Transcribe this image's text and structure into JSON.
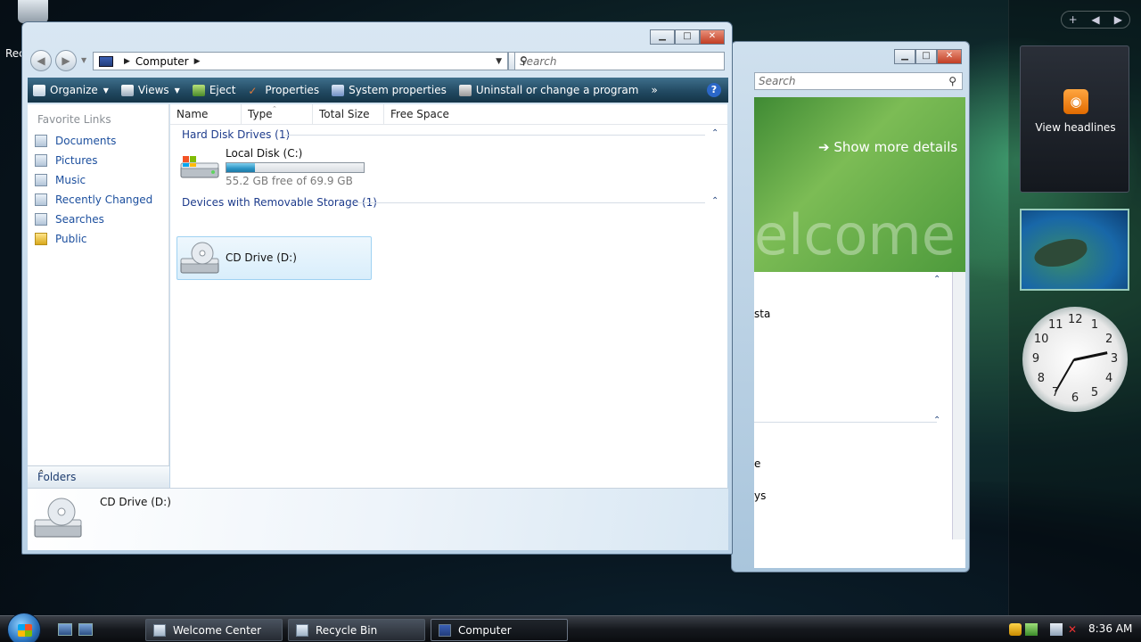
{
  "desktop": {
    "recycle_label": "Rec"
  },
  "sidebar": {
    "add_label": "+",
    "prev_label": "◀",
    "next_label": "▶",
    "rss_label": "View headlines",
    "clock_numbers": [
      "12",
      "1",
      "2",
      "3",
      "4",
      "5",
      "6",
      "7",
      "8",
      "9",
      "10",
      "11"
    ]
  },
  "welcome_window": {
    "search_placeholder": "Search",
    "show_more": "Show more details",
    "banner_word": "elcome",
    "text_1": "sta",
    "text_2": "e",
    "text_3": "ys"
  },
  "explorer": {
    "address": "Computer",
    "search_placeholder": "Search",
    "toolbar": {
      "organize": "Organize",
      "views": "Views",
      "eject": "Eject",
      "properties": "Properties",
      "system_properties": "System properties",
      "uninstall": "Uninstall or change a program",
      "more": "»",
      "help": "?"
    },
    "favorites_title": "Favorite Links",
    "favorites": [
      "Documents",
      "Pictures",
      "Music",
      "Recently Changed",
      "Searches",
      "Public"
    ],
    "folders_label": "Folders",
    "columns": [
      "Name",
      "Type",
      "Total Size",
      "Free Space"
    ],
    "groups": {
      "hard_disk": "Hard Disk Drives (1)",
      "removable": "Devices with Removable Storage (1)"
    },
    "local_disk": {
      "name": "Local Disk (C:)",
      "usage_fraction": 0.21,
      "free_text": "55.2 GB free of 69.9 GB"
    },
    "cd_drive": {
      "name": "CD Drive (D:)"
    },
    "details_name": "CD Drive (D:)"
  },
  "taskbar": {
    "tasks": [
      "Welcome Center",
      "Recycle Bin",
      "Computer"
    ],
    "time": "8:36 AM"
  }
}
